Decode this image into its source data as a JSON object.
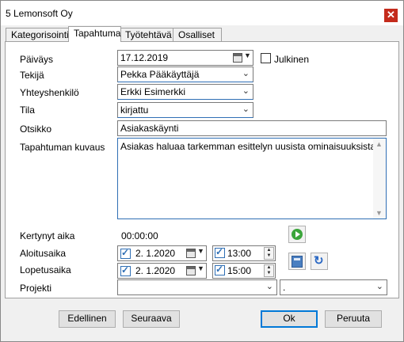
{
  "window": {
    "title": "5 Lemonsoft Oy",
    "close_glyph": "✕"
  },
  "tabs": [
    "Kategorisointi",
    "Tapahtuma",
    "Työtehtävä",
    "Osalliset"
  ],
  "active_tab": "Tapahtuma",
  "form": {
    "date": {
      "label": "Päiväys",
      "value": "17.12.2019"
    },
    "public": {
      "label": "Julkinen",
      "checked": false
    },
    "doer": {
      "label": "Tekijä",
      "value": "Pekka Pääkäyttäjä"
    },
    "contact": {
      "label": "Yhteyshenkilö",
      "value": "Erkki Esimerkki"
    },
    "state": {
      "label": "Tila",
      "value": "kirjattu"
    },
    "subject": {
      "label": "Otsikko",
      "value": "Asiakaskäynti"
    },
    "description": {
      "label": "Tapahtuman kuvaus",
      "value": "Asiakas haluaa tarkemman esittelyn uusista ominaisuuksista."
    },
    "accrued": {
      "label": "Kertynyt aika",
      "value": "00:00:00"
    },
    "start": {
      "label": "Aloitusaika",
      "date": "2. 1.2020",
      "time": "13:00",
      "checked": true
    },
    "end": {
      "label": "Lopetusaika",
      "date": "2. 1.2020",
      "time": "15:00",
      "checked": true
    },
    "project": {
      "label": "Projekti",
      "value": "",
      "sub_value": "."
    }
  },
  "buttons": {
    "previous": "Edellinen",
    "next": "Seuraava",
    "ok": "Ok",
    "cancel": "Peruuta"
  },
  "colors": {
    "accent": "#0078d7",
    "close": "#c42b1c",
    "play": "#3ba53b"
  },
  "icons": {
    "start_timer": "play-icon",
    "calculate": "calculator-icon",
    "refresh": "refresh-icon",
    "calendar": "calendar-icon"
  }
}
